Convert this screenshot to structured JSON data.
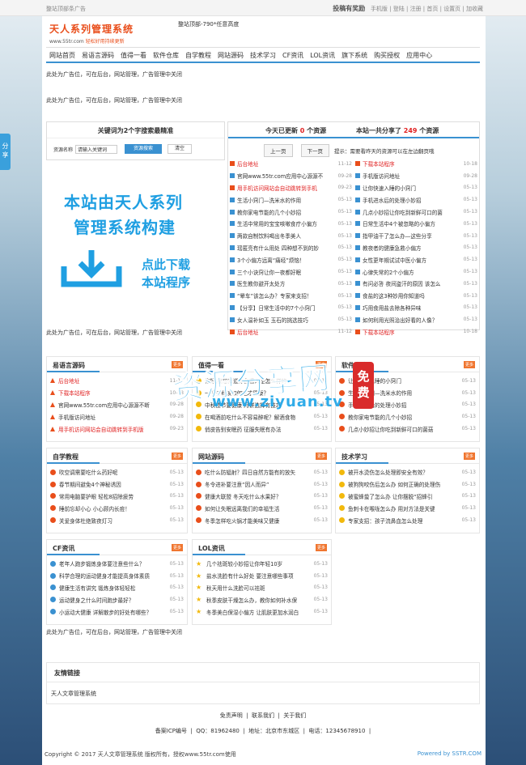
{
  "topbar": {
    "left": "整站顶部条广告",
    "right_main": "投稿有奖励",
    "links": [
      "手机版",
      "登陆",
      "注册",
      "首页",
      "设置页",
      "加收藏"
    ]
  },
  "share": "分享",
  "logo": {
    "title": "天人系列管理系统",
    "url": "www.55tr.com",
    "slogan": "轻松好用持续更新"
  },
  "head_ad": "整站顶部-790*任意高度",
  "nav": [
    "网站首页",
    "易语言源码",
    "值得一看",
    "软件仓库",
    "自学教程",
    "网站源码",
    "技术学习",
    "CF资讯",
    "LOL资讯",
    "旗下系统",
    "购买授权",
    "应用中心"
  ],
  "ads": {
    "a1": "此处为广告位，可在后台，网站管理，广告管理中关闭",
    "a2": "此处为广告位，可在后台，网站管理，广告管理中关闭",
    "a3": "此处为广告位，可在后台，网站管理，广告管理中关闭",
    "a4": "此处为广告位，可在后台，网站管理，广告管理中关闭"
  },
  "search": {
    "title": "关键词为2个字搜索最精准",
    "label": "资源名称",
    "placeholder": "请输入关键词",
    "search_btn": "资源搜索",
    "clear_btn": "清空"
  },
  "banner": {
    "line1": "本站由天人系列",
    "line2": "管理系统构建",
    "line3": "点此下载",
    "line4": "本站程序"
  },
  "stats": {
    "today_prefix": "今天已更新",
    "today_num": "0",
    "today_suffix": "个资源",
    "total_prefix": "本站一共分享了",
    "total_num": "249",
    "total_suffix": "个资源",
    "prev": "上一页",
    "next": "下一页",
    "tip": "提示：需要看昨天的资源可以在左边翻页哦"
  },
  "recent_left": [
    {
      "t": "后台地址",
      "d": "11-12",
      "red": true
    },
    {
      "t": "官网www.55tr.com应用中心源源不",
      "d": "09-28"
    },
    {
      "t": "用手机访问网站会自动跳转到手机",
      "d": "09-23",
      "red": true
    },
    {
      "t": "生活小窍门—洗米水的作用",
      "d": "05-13"
    },
    {
      "t": "教你家电节能的几个小妙招",
      "d": "05-13"
    },
    {
      "t": "生活中常用的宝宝咳嗽食疗小偏方",
      "d": "05-13"
    },
    {
      "t": "两款自制饮料喝出冬季美人",
      "d": "05-13"
    },
    {
      "t": "瑶匿亮有什么用处 四种想不到的妙",
      "d": "05-13"
    },
    {
      "t": "3个小偏方远离“痛经”烦恼！",
      "d": "05-13"
    },
    {
      "t": "三个小诀窍让你一夜都好眠",
      "d": "05-13"
    },
    {
      "t": "医生教你避开太处方",
      "d": "05-13"
    },
    {
      "t": "“晕车”该怎么办？专家来支招！",
      "d": "05-13"
    },
    {
      "t": "【分享】日常生活中的7个小窍门",
      "d": "05-13"
    },
    {
      "t": "女人温补如玉 玉石的挑选技巧",
      "d": "05-13"
    },
    {
      "t": "后台地址",
      "d": "11-12",
      "red": true
    }
  ],
  "recent_right": [
    {
      "t": "下载本站程序",
      "d": "10-18",
      "red": true
    },
    {
      "t": "手机版访问地址",
      "d": "09-28"
    },
    {
      "t": "让你快速入睡的小窍门",
      "d": "05-13"
    },
    {
      "t": "手机进水后的处理小妙招",
      "d": "05-13"
    },
    {
      "t": "几点小妙招让你吃到新鲜可口的菌",
      "d": "05-13"
    },
    {
      "t": "日常生活中4个被忽略的小偏方",
      "d": "05-13"
    },
    {
      "t": "指甲油干了怎么办—这些分享",
      "d": "05-13"
    },
    {
      "t": "教夜者的健康急救小偏方",
      "d": "05-13"
    },
    {
      "t": "女性更年期试试中医小偏方",
      "d": "05-13"
    },
    {
      "t": "心律失常的2个小偏方",
      "d": "05-13"
    },
    {
      "t": "有问必答 夜间盗汗的原因 该怎么",
      "d": "05-13"
    },
    {
      "t": "食盐的这3种妙用你知道吗",
      "d": "05-13"
    },
    {
      "t": "巧用食用盐去除各种异味",
      "d": "05-13"
    },
    {
      "t": "如何利用光照治出好看的人像？",
      "d": "05-13"
    },
    {
      "t": "下载本站程序",
      "d": "10-18",
      "red": true
    }
  ],
  "sec_yiyuyan": {
    "title": "易语言源码",
    "more": "更多",
    "items": [
      {
        "t": "后台地址",
        "d": "11-12",
        "red": true
      },
      {
        "t": "下载本站程序",
        "d": "10-18",
        "red": true
      },
      {
        "t": "官网www.55tr.com应用中心源源不断",
        "d": "09-28"
      },
      {
        "t": "手机版访问地址",
        "d": "09-28"
      },
      {
        "t": "用手机访问网站会自动跳转到手机版",
        "d": "09-23",
        "red": true
      }
    ]
  },
  "sec_zhide": {
    "title": "值得一看",
    "more": "更多",
    "items": [
      {
        "t": "你好,我想知道你在看人是怎么样的",
        "d": "05-13"
      },
      {
        "t": "一千三餐该如何吃才健康？",
        "d": "05-13"
      },
      {
        "t": "中秋佳节要健康 月饼选择有技巧",
        "d": "05-13"
      },
      {
        "t": "在喝酒前吃什么不容易醉呢？解酒食物",
        "d": "05-13"
      },
      {
        "t": "俏皮告别安眠药 征服失眠有办法",
        "d": "05-13"
      }
    ]
  },
  "sec_ruanjian": {
    "title": "软件仓库",
    "more": "更多",
    "items": [
      {
        "t": "让你快速入睡的小窍门",
        "d": "05-13"
      },
      {
        "t": "生活小窍门—洗米水的作用",
        "d": "05-13"
      },
      {
        "t": "手机进水后的处理小妙招",
        "d": "05-13"
      },
      {
        "t": "教你家电节能的几个小妙招",
        "d": "05-13"
      },
      {
        "t": "几点小妙招让你吃到新鲜可口的菌菇",
        "d": "05-13"
      }
    ]
  },
  "sec_zixue": {
    "title": "自学教程",
    "more": "更多",
    "items": [
      {
        "t": "吹空调需要吃什么药好呢",
        "d": "05-13"
      },
      {
        "t": "春节期间避免4个神秘诱因",
        "d": "05-13"
      },
      {
        "t": "常用电脑要护眼 轻松8招除疲劳",
        "d": "05-13"
      },
      {
        "t": "睡前忘却小心 小心顾内长痘！",
        "d": "05-13"
      },
      {
        "t": "关爱身体杜绝致夜灯习",
        "d": "05-13"
      }
    ]
  },
  "sec_wangzhan": {
    "title": "网站源码",
    "more": "更多",
    "items": [
      {
        "t": "吃什么防辐射？四日自然方能有的放矢",
        "d": "05-13"
      },
      {
        "t": "冬令进补要注意“因人而异”",
        "d": "05-13"
      },
      {
        "t": "健康大联盟 冬天吃什么水果好？",
        "d": "05-13"
      },
      {
        "t": "如何让失眠远离我们的幸福生活",
        "d": "05-13"
      },
      {
        "t": "冬季怎样吃火锅才能美味又健康",
        "d": "05-13"
      }
    ]
  },
  "sec_jishu": {
    "title": "技术学习",
    "more": "更多",
    "items": [
      {
        "t": "被开水烫伤怎么处理即安全有效？",
        "d": "05-13"
      },
      {
        "t": "被狗狗咬伤后怎么办 如何正确的处理伤",
        "d": "05-13"
      },
      {
        "t": "被蜜蜂蛰了怎么办 让你摆脱“招蜂引",
        "d": "05-13"
      },
      {
        "t": "鱼刺卡在喉咙怎么办 用对方法是关键",
        "d": "05-13"
      },
      {
        "t": "专家支招：孩子流鼻血怎么处理",
        "d": "05-13"
      }
    ]
  },
  "sec_cf": {
    "title": "CF资讯",
    "more": "更多",
    "items": [
      {
        "t": "老年人跑步锻炼身体要注意些什么？",
        "d": "05-13"
      },
      {
        "t": "科学合理的运动健身才能提高身体素质",
        "d": "05-13"
      },
      {
        "t": "健康生活有讲究 锻炼身体轻轻松",
        "d": "05-13"
      },
      {
        "t": "运动健身之什么时间跑步最好？",
        "d": "05-13"
      },
      {
        "t": "小运动大健康 详解散步的好处有哪些？",
        "d": "05-13"
      }
    ]
  },
  "sec_lol": {
    "title": "LOL资讯",
    "more": "更多",
    "items": [
      {
        "t": "几个祛斑较小妙招让你年轻10岁",
        "d": "05-13"
      },
      {
        "t": "盐水洗脸有什么好处 要注意哪些事项",
        "d": "05-13"
      },
      {
        "t": "秋天用什么洗脸可以祛斑",
        "d": "05-13"
      },
      {
        "t": "秋季皮肤干燥怎么办，教你如何补水保",
        "d": "05-13"
      },
      {
        "t": "冬季美白保湿小偏方 让肌肤更加水润白",
        "d": "05-13"
      }
    ]
  },
  "links": {
    "title": "友情链接",
    "item": "天人文章管理系统"
  },
  "footer": {
    "line1": [
      "免责声明",
      "联系我们",
      "关于我们"
    ],
    "icp": "备案ICP编号",
    "qq": "QQ：81962480",
    "addr": "地址：北京市东城区",
    "tel": "电话：12345678910",
    "copyright": "Copyright © 2017 天人文章管理系统 版权所有，授权www.55tr.com使用",
    "powered": "Powered by SSTR.COM"
  },
  "watermark": {
    "main": "资源分享网",
    "sub": "www.ziyuan.tv",
    "seal": "免费"
  }
}
